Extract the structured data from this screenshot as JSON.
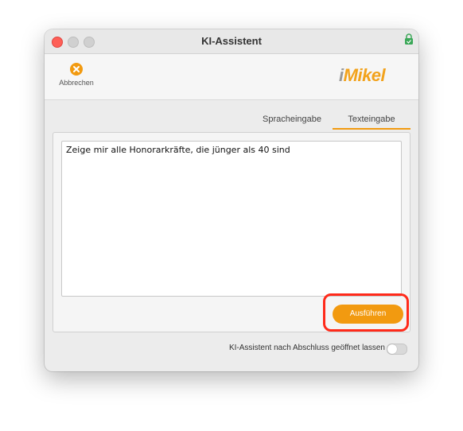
{
  "window": {
    "title": "KI-Assistent"
  },
  "toolbar": {
    "cancel_label": "Abbrechen",
    "logo_i": "i",
    "logo_rest": "Mikel"
  },
  "tabs": [
    {
      "label": "Spracheingabe",
      "active": false
    },
    {
      "label": "Texteingabe",
      "active": true
    }
  ],
  "editor": {
    "text": "Zeige mir alle Honorarkräfte, die jünger als 40 sind"
  },
  "actions": {
    "run_label": "Ausführen"
  },
  "footer": {
    "keep_open_label": "KI-Assistent nach Abschluss geöffnet lassen",
    "keep_open_enabled": false
  },
  "colors": {
    "accent": "#f29a10",
    "highlight": "#ff2a1a",
    "close": "#fe5f57"
  }
}
